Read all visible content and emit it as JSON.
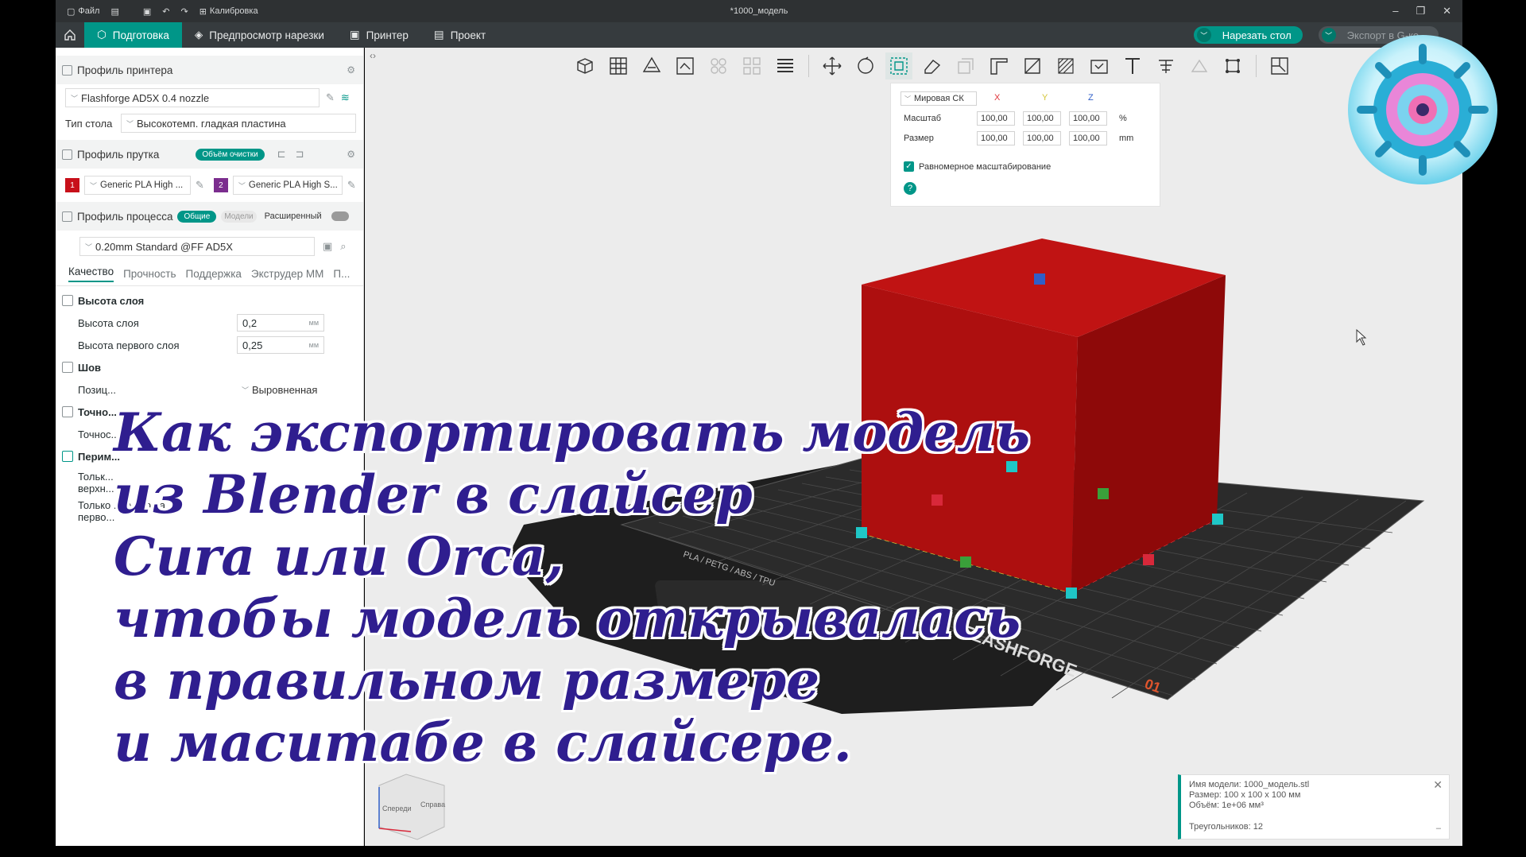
{
  "titlebar": {
    "file_label": "Файл",
    "calibration_label": "Калибровка",
    "window_title": "*1000_модель"
  },
  "tabs": [
    {
      "label": "Подготовка"
    },
    {
      "label": "Предпросмотр нарезки"
    },
    {
      "label": "Принтер"
    },
    {
      "label": "Проект"
    }
  ],
  "actions": {
    "slice_label": "Нарезать стол",
    "export_label": "Экспорт в G-ко..."
  },
  "printer": {
    "section_title": "Профиль принтера",
    "printer_name": "Flashforge AD5X 0.4 nozzle",
    "bed_type_label": "Тип стола",
    "bed_type_value": "Высокотемп. гладкая пластина"
  },
  "filament": {
    "section_title": "Профиль прутка",
    "purge_tag": "Объём очистки",
    "items": [
      {
        "num": "1",
        "color": "#c8101a",
        "name": "Generic PLA High ..."
      },
      {
        "num": "2",
        "color": "#7b2d8e",
        "name": "Generic PLA High S..."
      }
    ]
  },
  "process": {
    "section_title": "Профиль процесса",
    "tag_general": "Общие",
    "tag_models": "Модели",
    "advanced_label": "Расширенный",
    "profile_name": "0.20mm Standard @FF AD5X",
    "tabs": [
      "Качество",
      "Прочность",
      "Поддержка",
      "Экструдер ММ",
      "П..."
    ],
    "layer_group": "Высота слоя",
    "layer_height_label": "Высота слоя",
    "layer_height_value": "0,2",
    "first_layer_label": "Высота первого слоя",
    "first_layer_value": "0,25",
    "unit_mm": "мм",
    "seam_group": "Шов",
    "seam_pos_label": "Позиц...",
    "seam_pos_value": "Выровненная",
    "precision_group": "Точно...",
    "precision_label": "Точнос...",
    "perimeter_group": "Перим...",
    "only_top_label": "Тольк...",
    "only_top_label2": "верхн...",
    "only_first_label": "Только ...иметр на",
    "only_first_label2": "перво..."
  },
  "scale_panel": {
    "coord_system": "Мировая СК",
    "axis_x": "X",
    "axis_y": "Y",
    "axis_z": "Z",
    "scale_label": "Масштаб",
    "scale_values": [
      "100,00",
      "100,00",
      "100,00"
    ],
    "scale_unit": "%",
    "size_label": "Размер",
    "size_values": [
      "100,00",
      "100,00",
      "100,00"
    ],
    "size_unit": "mm",
    "uniform_label": "Равномерное масштабирование",
    "help": "?"
  },
  "info_panel": {
    "model_name": "Имя модели: 1000_модель.stl",
    "size": "Размер: 100 x 100 x 100 мм",
    "volume": "Объём: 1e+06 мм³",
    "triangles": "Треугольников: 12"
  },
  "bed": {
    "brand": "FLASHFORGE",
    "material_text": "PLA / PETG / ABS / TPU",
    "plate_number": "01"
  },
  "view_cube": {
    "front": "Спереди",
    "right": "Справа"
  },
  "overlay": {
    "lines": [
      "Как экспортировать модель",
      "из Blender в слайсер",
      "Cura или Orca,",
      "чтобы модель открывалась",
      "в правильном размере",
      "и маситабе в слайсере."
    ]
  },
  "colors": {
    "accent": "#009688",
    "cube": "#b01010",
    "overlay_text": "#2f1e8f"
  }
}
